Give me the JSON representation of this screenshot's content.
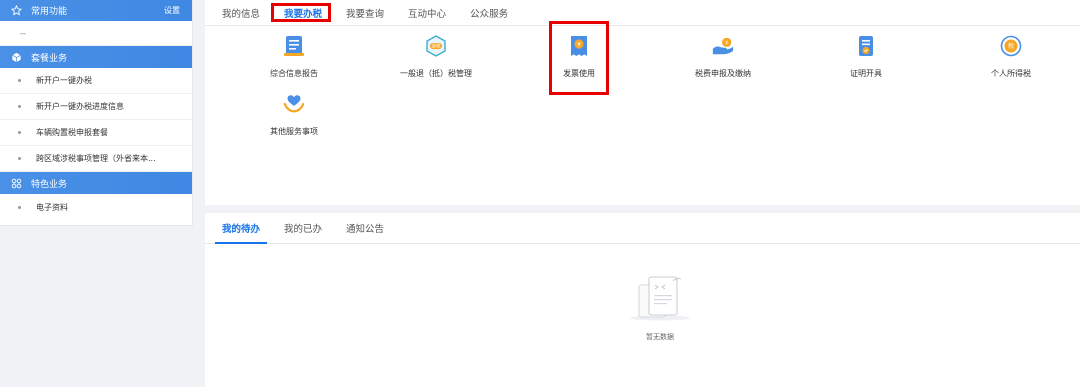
{
  "sidebar": {
    "common": {
      "title": "常用功能",
      "settings": "设置",
      "placeholder": "--"
    },
    "package": {
      "title": "套餐业务",
      "items": [
        "新开户一键办税",
        "新开户一键办税进度信息",
        "车辆购置税申报套餐",
        "跨区域涉税事项管理（外省来本..."
      ]
    },
    "special": {
      "title": "特色业务",
      "items": [
        "电子资料"
      ]
    }
  },
  "top_tabs": [
    "我的信息",
    "我要办税",
    "我要查询",
    "互动中心",
    "公众服务"
  ],
  "services": [
    {
      "label": "综合信息报告",
      "icon": "report-icon"
    },
    {
      "label": "一般退（抵）税管理",
      "icon": "refund-icon"
    },
    {
      "label": "发票使用",
      "icon": "invoice-icon"
    },
    {
      "label": "税费申报及缴纳",
      "icon": "pay-icon"
    },
    {
      "label": "证明开具",
      "icon": "certificate-icon"
    },
    {
      "label": "个人所得税",
      "icon": "personal-tax-icon"
    },
    {
      "label": "其他服务事项",
      "icon": "other-services-icon"
    }
  ],
  "bottom_tabs": [
    "我的待办",
    "我的已办",
    "通知公告"
  ],
  "empty_text": "暂无数据",
  "colors": {
    "accent": "#1a73e8",
    "highlight": "#e60000",
    "sidebar_header": "#4a90e6"
  }
}
